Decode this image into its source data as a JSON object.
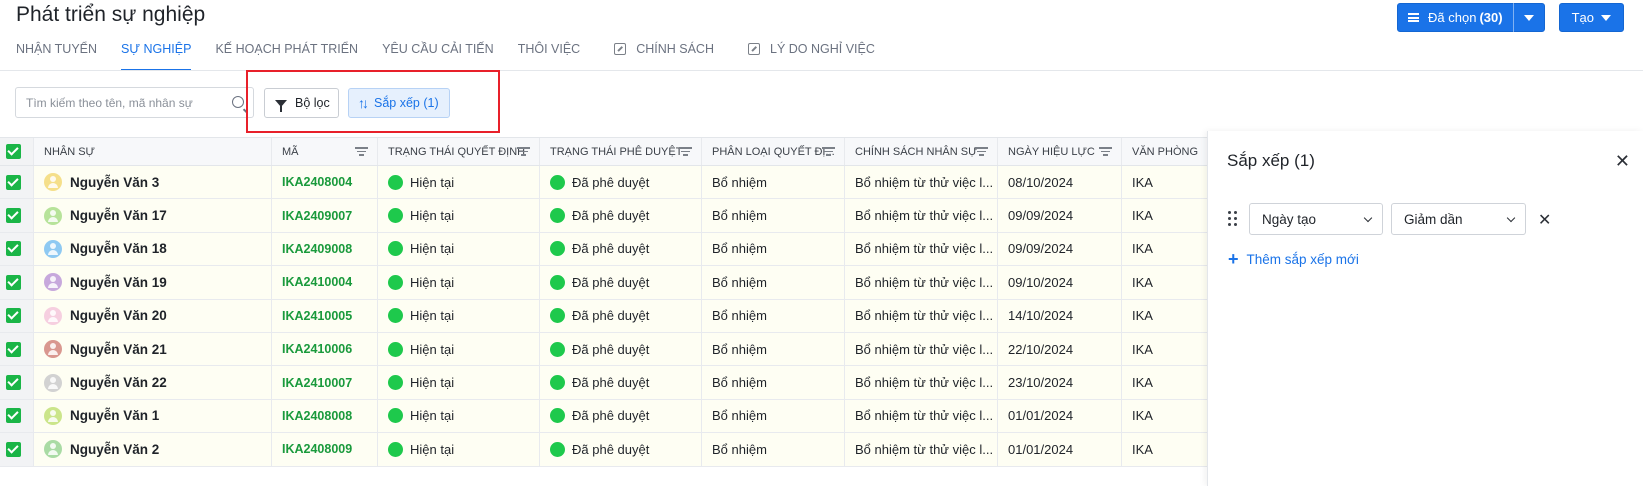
{
  "header": {
    "title": "Phát triển sự nghiệp",
    "selected_label": "Đã chọn",
    "selected_count": "(30)",
    "create_label": "Tạo"
  },
  "tabs": [
    {
      "label": "NHẬN TUYỂN"
    },
    {
      "label": "SỰ NGHIỆP"
    },
    {
      "label": "KẾ HOẠCH PHÁT TRIỂN"
    },
    {
      "label": "YÊU CẦU CẢI TIẾN"
    },
    {
      "label": "THÔI VIỆC"
    },
    {
      "label": "CHÍNH SÁCH"
    },
    {
      "label": "LÝ DO NGHỈ VIỆC"
    }
  ],
  "toolbar": {
    "search_placeholder": "Tìm kiếm theo tên, mã nhân sự",
    "filter_label": "Bộ lọc",
    "sort_label": "Sắp xếp (1)"
  },
  "table": {
    "columns": [
      "NHÂN SỰ",
      "MÃ",
      "TRẠNG THÁI QUYẾT ĐỊNH",
      "TRẠNG THÁI PHÊ DUYỆT",
      "PHÂN LOẠI QUYẾT ĐỊ...",
      "CHÍNH SÁCH NHÂN SỰ",
      "NGÀY HIỆU LỰC",
      "VĂN PHÒNG"
    ],
    "rows": [
      {
        "name": "Nguyễn Văn 3",
        "avatar_color": "#f5df8a",
        "code": "IKA2408004",
        "decision_status": "Hiện tại",
        "approval_status": "Đã phê duyệt",
        "type": "Bổ nhiệm",
        "policy": "Bổ nhiệm từ thử việc l...",
        "date": "08/10/2024",
        "office": "IKA"
      },
      {
        "name": "Nguyễn Văn 17",
        "avatar_color": "#b7e39a",
        "code": "IKA2409007",
        "decision_status": "Hiện tại",
        "approval_status": "Đã phê duyệt",
        "type": "Bổ nhiệm",
        "policy": "Bổ nhiệm từ thử việc l...",
        "date": "09/09/2024",
        "office": "IKA"
      },
      {
        "name": "Nguyễn Văn 18",
        "avatar_color": "#8ec9f2",
        "code": "IKA2409008",
        "decision_status": "Hiện tại",
        "approval_status": "Đã phê duyệt",
        "type": "Bổ nhiệm",
        "policy": "Bổ nhiệm từ thử việc l...",
        "date": "09/09/2024",
        "office": "IKA"
      },
      {
        "name": "Nguyễn Văn 19",
        "avatar_color": "#c7a8dc",
        "code": "IKA2410004",
        "decision_status": "Hiện tại",
        "approval_status": "Đã phê duyệt",
        "type": "Bổ nhiệm",
        "policy": "Bổ nhiệm từ thử việc l...",
        "date": "09/10/2024",
        "office": "IKA"
      },
      {
        "name": "Nguyễn Văn 20",
        "avatar_color": "#f6cfe0",
        "code": "IKA2410005",
        "decision_status": "Hiện tại",
        "approval_status": "Đã phê duyệt",
        "type": "Bổ nhiệm",
        "policy": "Bổ nhiệm từ thử việc l...",
        "date": "14/10/2024",
        "office": "IKA"
      },
      {
        "name": "Nguyễn Văn 21",
        "avatar_color": "#d9978f",
        "code": "IKA2410006",
        "decision_status": "Hiện tại",
        "approval_status": "Đã phê duyệt",
        "type": "Bổ nhiệm",
        "policy": "Bổ nhiệm từ thử việc l...",
        "date": "22/10/2024",
        "office": "IKA"
      },
      {
        "name": "Nguyễn Văn 22",
        "avatar_color": "#d2d2d2",
        "code": "IKA2410007",
        "decision_status": "Hiện tại",
        "approval_status": "Đã phê duyệt",
        "type": "Bổ nhiệm",
        "policy": "Bổ nhiệm từ thử việc l...",
        "date": "23/10/2024",
        "office": "IKA"
      },
      {
        "name": "Nguyễn Văn 1",
        "avatar_color": "#cbe58a",
        "code": "IKA2408008",
        "decision_status": "Hiện tại",
        "approval_status": "Đã phê duyệt",
        "type": "Bổ nhiệm",
        "policy": "Bổ nhiệm từ thử việc l...",
        "date": "01/01/2024",
        "office": "IKA"
      },
      {
        "name": "Nguyễn Văn 2",
        "avatar_color": "#a9dba4",
        "code": "IKA2408009",
        "decision_status": "Hiện tại",
        "approval_status": "Đã phê duyệt",
        "type": "Bổ nhiệm",
        "policy": "Bổ nhiệm từ thử việc l...",
        "date": "01/01/2024",
        "office": "IKA"
      }
    ]
  },
  "sort_panel": {
    "title": "Sắp xếp (1)",
    "rules": [
      {
        "field": "Ngày tạo",
        "direction": "Giảm dần"
      }
    ],
    "add_label": "Thêm sắp xếp mới"
  },
  "colors": {
    "accent": "#1a73e8",
    "status_green": "#1ec94c",
    "code_green": "#1a9a3c",
    "checkbox_green": "#1ab547",
    "highlight_red": "#e8202a"
  },
  "icons": {
    "menu": "menu-icon",
    "search": "search-icon",
    "filter": "filter-icon",
    "sort": "sort-icon",
    "external": "external-link-icon",
    "close": "close-icon",
    "drag": "drag-handle-icon",
    "plus": "plus-icon"
  }
}
